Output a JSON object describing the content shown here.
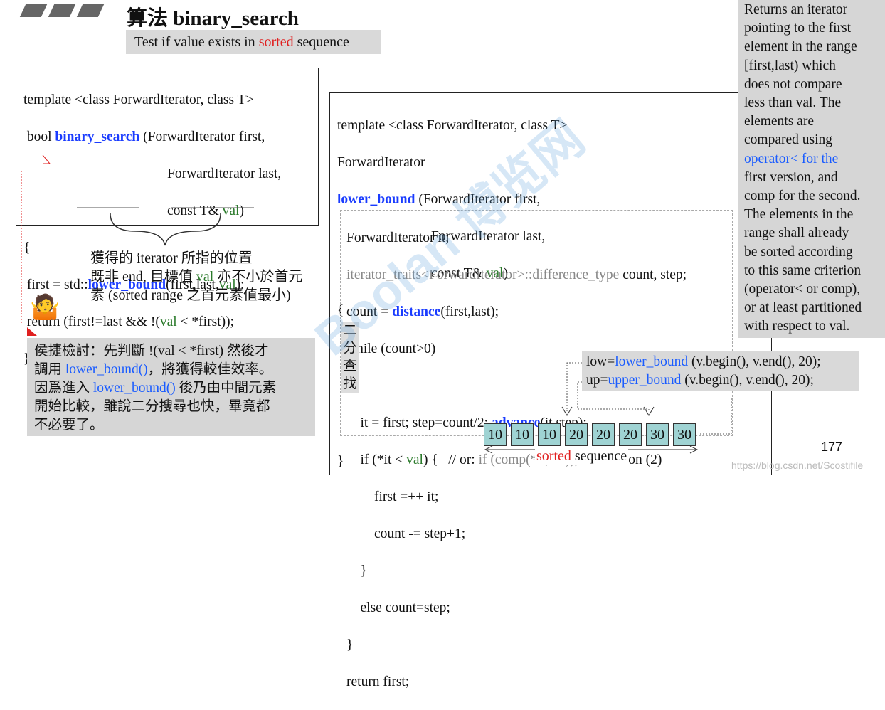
{
  "header": {
    "title": "算法 binary_search",
    "subtitle_pre": "Test if value exists in ",
    "subtitle_red": "sorted",
    "subtitle_post": " sequence"
  },
  "left_code": {
    "l1": "template <class ForwardIterator, class T>",
    "l2_pre": " bool ",
    "l2_fn": "binary_search",
    "l2_post": " (ForwardIterator first,",
    "l3": "ForwardIterator last,",
    "l4_pre": "const T& ",
    "l4_val": "val",
    "l4_post": ")",
    "l5": "{",
    "l6_pre": " first = std::",
    "l6_fn": "lower_bound",
    "l6_mid": "(first,last,",
    "l6_val": "val",
    "l6_post": ");",
    "l7_pre": " return (first!=last && !(",
    "l7_val": "val",
    "l7_post": " < *first));",
    "l8": "}"
  },
  "annotation": {
    "l1": "獲得的 iterator 所指的位置",
    "l2_pre": "既非 end, 目標值 ",
    "l2_val": "val",
    "l2_post": " 亦不小於首元",
    "l3": "素 (sorted range 之首元素值最小)"
  },
  "note": {
    "l1": "侯捷檢討：先判斷 !(val < *first) 然後才",
    "l2_pre": "調用 ",
    "l2_fn": "lower_bound()",
    "l2_post": "，將獲得較佳效率。",
    "l3_pre": "因爲進入 ",
    "l3_fn": "lower_bound()",
    "l3_post": " 後乃由中間元素",
    "l4": "開始比較，雖說二分搜尋也快，畢竟都",
    "l5": "不必要了。"
  },
  "right_code": {
    "l1": "template <class ForwardIterator, class T>",
    "l2": "ForwardIterator",
    "l3_fn": "lower_bound",
    "l3_post": " (ForwardIterator first,",
    "l4": "ForwardIterator last,",
    "l5_pre": "const T& ",
    "l5_val": "val",
    "l5_post": ")",
    "l6": "{",
    "b1": "ForwardIterator it;",
    "b2_gray": "iterator_traits<ForwardIterator>::difference_type",
    "b2_post": " count, step;",
    "b3_pre": "count = ",
    "b3_fn": "distance",
    "b3_post": "(first,last);",
    "b4": "while (count>0)",
    "b5": "{",
    "b6_pre": "    it = first; step=count/2; ",
    "b6_fn": "advance",
    "b6_post": "(it,step);",
    "b7_pre": "    if (*it < ",
    "b7_val": "val",
    "b7_mid": ") {   // or: ",
    "b7_gray": "if (comp(*it,val)),",
    "b7_post": " for version (2)",
    "b8": "        first =++ it;",
    "b9": "        count -= step+1;",
    "b10": "    }",
    "b11": "    else count=step;",
    "b12": "}",
    "b13": "return first;",
    "end": "}"
  },
  "side_label": [
    "二",
    "分",
    "查",
    "找"
  ],
  "usage": {
    "low_pre": "low=",
    "low_fn": "lower_bound",
    "low_post": " (v.begin(), v.end(), 20);",
    "up_pre": "up=",
    "up_fn": "upper_bound",
    "up_post": " (v.begin(), v.end(), 20);"
  },
  "sequence": {
    "values": [
      "10",
      "10",
      "10",
      "20",
      "20",
      "20",
      "30",
      "30"
    ],
    "label_red": "sorted",
    "label_post": " sequence"
  },
  "description": {
    "lines": [
      "Returns an iterator",
      "pointing to the first",
      "element in the range",
      "[first,last) which",
      "does not compare",
      "less than val. The",
      "elements are",
      "compared using",
      "operator< for the",
      "first version, and",
      "comp for the second.",
      "The elements in the",
      "range shall already",
      "be sorted according",
      "to this same criterion",
      "(operator< or comp),",
      "or at least partitioned",
      "with respect to val."
    ]
  },
  "page_number": "177",
  "watermark": {
    "brand": "Boolan 博览网",
    "url": "https://blog.csdn.net/Scostifile"
  }
}
